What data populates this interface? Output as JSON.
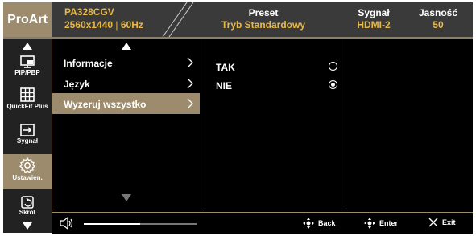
{
  "header": {
    "logo": "ProArt",
    "model": "PA328CGV",
    "resolution": "2560x1440",
    "refresh": "60Hz",
    "preset_label": "Preset",
    "preset_value": "Tryb Standardowy",
    "signal_label": "Sygnał",
    "signal_value": "HDMI-2",
    "brightness_label": "Jasność",
    "brightness_value": "50"
  },
  "sidebar": {
    "items": [
      {
        "label": "PIP/PBP",
        "icon": "pip-icon"
      },
      {
        "label": "QuickFit Plus",
        "icon": "grid-icon"
      },
      {
        "label": "Sygnał",
        "icon": "input-icon"
      },
      {
        "label": "Ustawien.",
        "icon": "gear-icon"
      },
      {
        "label": "Skrót",
        "icon": "shortcut-icon"
      }
    ]
  },
  "menu": {
    "items": [
      {
        "label": "Informacje"
      },
      {
        "label": "Język"
      },
      {
        "label": "Wyzeruj wszystko"
      }
    ]
  },
  "options": {
    "items": [
      {
        "label": "TAK",
        "selected": false
      },
      {
        "label": "NIE",
        "selected": true
      }
    ]
  },
  "footer": {
    "volume_level": 0.5,
    "back_label": "Back",
    "enter_label": "Enter",
    "exit_label": "Exit"
  },
  "colors": {
    "accent": "#9c8b6c",
    "highlight_text": "#e8b84a",
    "background": "#000000"
  }
}
